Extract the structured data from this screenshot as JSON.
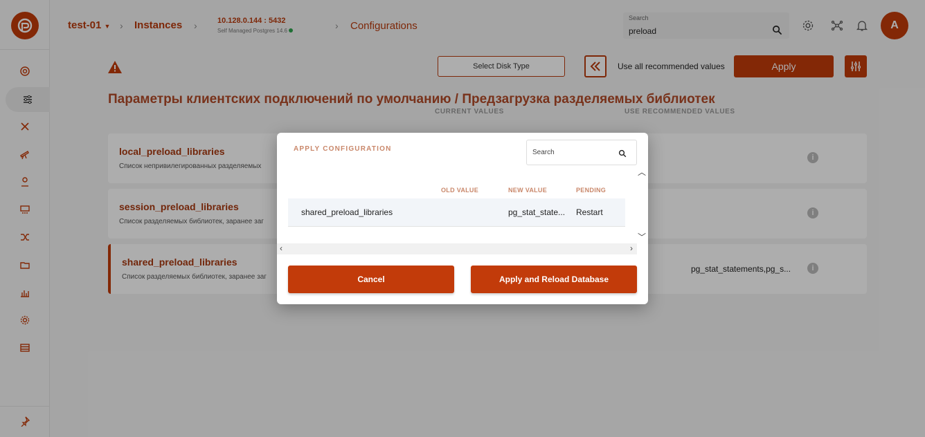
{
  "colors": {
    "accent": "#c23b0a",
    "title": "#b24a28"
  },
  "header": {
    "project": "test-01",
    "instances": "Instances",
    "host": "10.128.0.144 : 5432",
    "host_sub": "Self Managed Postgres 14.6",
    "configurations": "Configurations",
    "search_label": "Search",
    "search_value": "preload",
    "avatar_letter": "A"
  },
  "toolbar": {
    "select_disk": "Select Disk Type",
    "use_all": "Use all recommended values",
    "apply": "Apply"
  },
  "page": {
    "title": "Параметры клиентских подключений по умолчанию / Предзагрузка разделяемых библиотек",
    "col_current": "CURRENT VALUES",
    "col_recommended": "USE RECOMMENDED VALUES"
  },
  "cards": [
    {
      "name": "local_preload_libraries",
      "desc": "Список непривилегированных разделяемых",
      "current": ""
    },
    {
      "name": "session_preload_libraries",
      "desc": "Список разделяемых библиотек, заранее заг",
      "current": ""
    },
    {
      "name": "shared_preload_libraries",
      "desc": "Список разделяемых библиотек, заранее заг",
      "current": "pg_stat_statements,pg_s..."
    }
  ],
  "modal": {
    "title": "APPLY CONFIGURATION",
    "search_placeholder": "Search",
    "columns": {
      "old": "OLD VALUE",
      "new": "NEW VALUE",
      "pending": "PENDING"
    },
    "rows": [
      {
        "name": "shared_preload_libraries",
        "old": "",
        "new": "pg_stat_state...",
        "pending": "Restart"
      }
    ],
    "cancel": "Cancel",
    "apply_reload": "Apply and Reload Database"
  }
}
